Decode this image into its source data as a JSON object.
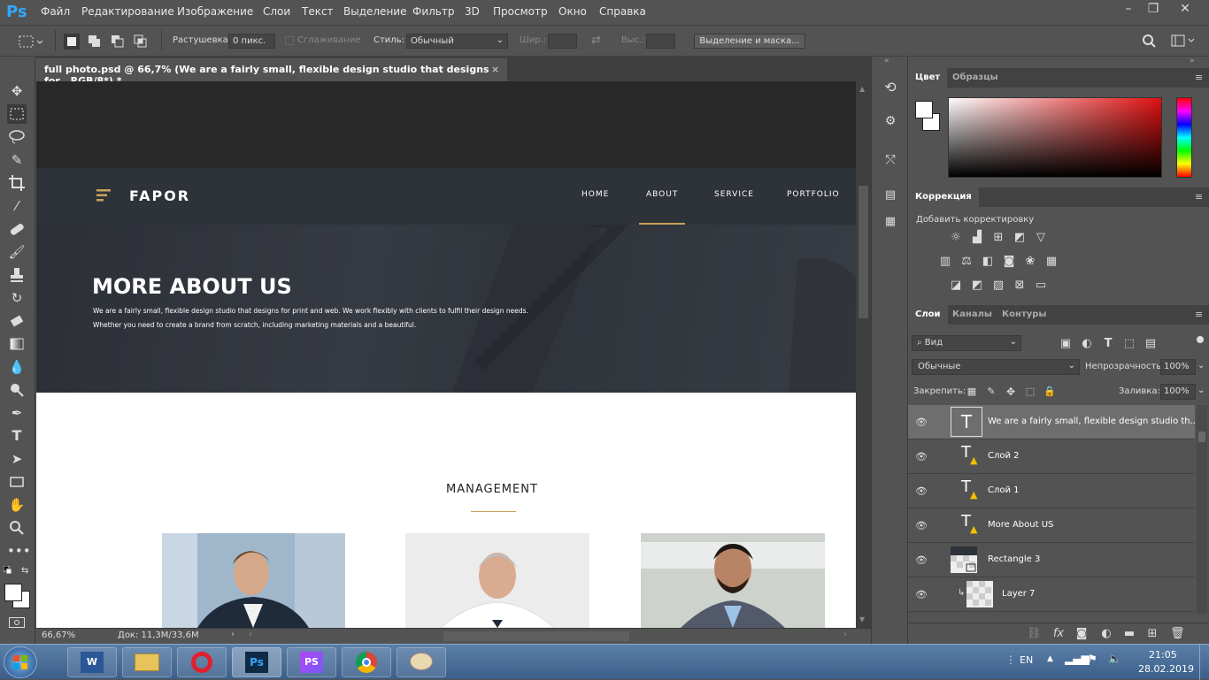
{
  "app": {
    "logo": "Ps"
  },
  "menu": [
    "Файл",
    "Редактирование",
    "Изображение",
    "Слои",
    "Текст",
    "Выделение",
    "Фильтр",
    "3D",
    "Просмотр",
    "Окно",
    "Справка"
  ],
  "options": {
    "feather_label": "Растушевка:",
    "feather_value": "0 пикс.",
    "antialias_label": "Сглаживание",
    "style_label": "Стиль:",
    "style_value": "Обычный",
    "width_label": "Шир.:",
    "height_label": "Выс.:",
    "mask_button": "Выделение и маска..."
  },
  "document": {
    "tab_title": "full photo.psd @ 66,7% (We are a fairly small, flexible design studio that designs for , RGB/8*) *"
  },
  "site": {
    "brand": "FAPOR",
    "nav": [
      "HOME",
      "ABOUT",
      "SERVICE",
      "PORTFOLIO"
    ],
    "active_nav": "ABOUT",
    "hero_title": "MORE ABOUT US",
    "hero_line1": "We are a fairly small, flexible design studio that designs for print and web. We work flexibly with clients to fulfil their design needs.",
    "hero_line2": "Whether you need to create a brand from scratch, including marketing materials and a beautiful.",
    "section_title": "MANAGEMENT",
    "accent": "#c9a25a"
  },
  "status": {
    "zoom": "66,67%",
    "doc": "Док: 11,3M/33,6M"
  },
  "panels": {
    "color_tabs": [
      "Цвет",
      "Образцы"
    ],
    "adjust_tab": "Коррекция",
    "adjust_hint": "Добавить корректировку",
    "layers_tabs": [
      "Слои",
      "Каналы",
      "Контуры"
    ],
    "filter_kind": "Вид",
    "blend_mode": "Обычные",
    "opacity_label": "Непрозрачность:",
    "opacity_value": "100%",
    "lock_label": "Закрепить:",
    "fill_label": "Заливка:",
    "fill_value": "100%"
  },
  "layers": [
    {
      "name": "We are a fairly small, flexible design studio th...",
      "kind": "text",
      "selected": true
    },
    {
      "name": "Слой 2",
      "kind": "text-warning"
    },
    {
      "name": "Слой 1",
      "kind": "text-warning"
    },
    {
      "name": "More About US",
      "kind": "text-warning"
    },
    {
      "name": "Rectangle 3",
      "kind": "shape"
    },
    {
      "name": "Layer 7",
      "kind": "image-clipped"
    }
  ],
  "taskbar": {
    "lang": "EN",
    "time": "21:05",
    "date": "28.02.2019"
  }
}
